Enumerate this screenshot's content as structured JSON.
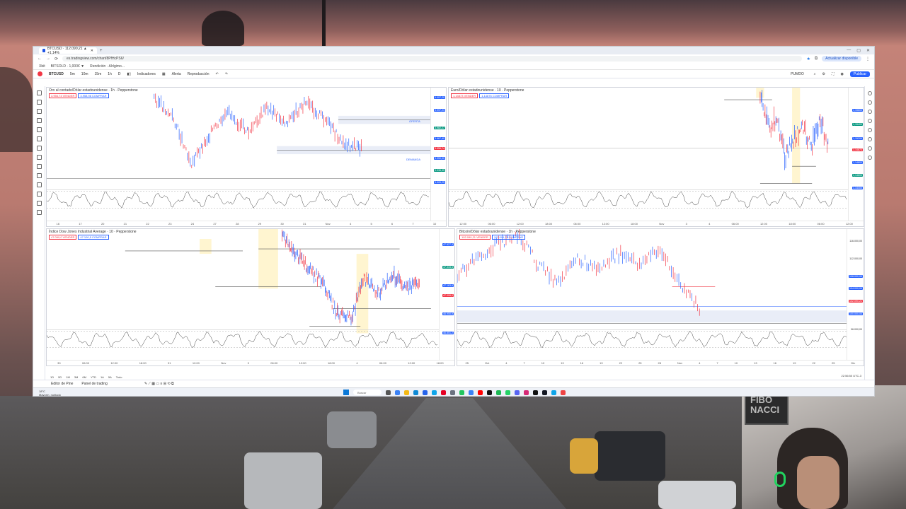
{
  "browser": {
    "tab_title": "BTCUSD · 112.090,21 ▲ +1,14%",
    "new_tab": "+",
    "url": "es.tradingview.com/chart/8PfHcPS6/",
    "account_button": "Actualizar disponible",
    "bookmarks": [
      "Xbit",
      "BITSOLD · 1,000€ ▼",
      "Rendición · Alrígimo..."
    ],
    "window_controls": [
      "—",
      "▢",
      "✕"
    ]
  },
  "toolbar": {
    "symbol": "BTCUSD",
    "intervals": [
      "5m",
      "10m",
      "15m",
      "1h",
      "D"
    ],
    "indicators_label": "Indicadores",
    "alert_label": "Alerta",
    "replay_label": "Reproducción",
    "layout_label": "PUMDO",
    "publish_label": "Publicar"
  },
  "panes": [
    {
      "title": "Oro al contado/Dólar estadounidense · 1h · Pepperstone",
      "sell": "3.956,74 VENDER",
      "buy": "3.958,98 COMPRAR",
      "zone_top": "OFERTA",
      "zone_bottom": "DEMANDA",
      "x_ticks": [
        "16",
        "17",
        "20",
        "21",
        "22",
        "23",
        "24",
        "27",
        "28",
        "29",
        "30",
        "31",
        "Nov",
        "4",
        "5",
        "6",
        "7",
        "10"
      ],
      "price_labels": [
        "4.007,20",
        "3.997,23",
        "3.982,27",
        "3.967,40",
        "3.956,74",
        "3.950,00",
        "3.936,35",
        "3.926,25"
      ]
    },
    {
      "title": "Euro/Dólar estadounidense · 10 · Pepperstone",
      "sell": "1,14873 VENDER",
      "buy": "1,14876 COMPRAR",
      "x_ticks": [
        "12:00",
        "06:00",
        "12:00",
        "18:00",
        "06:00",
        "12:00",
        "18:00",
        "Nov",
        "3",
        "4",
        "06:00",
        "12:00",
        "18:00",
        "06:00",
        "12:00"
      ],
      "price_labels": [
        "1,15600",
        "1,15400",
        "1,15200",
        "1,14873",
        "1,14800",
        "1,14600",
        "1,14400"
      ]
    },
    {
      "title": "Índice Dow Jones Industrial Average · 10 · Pepperstone",
      "sell": "47.099,0 VENDER",
      "buy": "47.100,5 COMPRAR",
      "x_ticks": [
        "30",
        "06:00",
        "12:00",
        "18:00",
        "31",
        "12:00",
        "Nov",
        "3",
        "06:00",
        "12:00",
        "18:00",
        "4",
        "06:00",
        "12:00",
        "18:00"
      ],
      "price_labels": [
        "47.527,3",
        "47.333,3",
        "47.163,6",
        "47.099,0",
        "46.950,9",
        "46.851,2"
      ]
    },
    {
      "title": "Bitcoin/Dólar estadounidense · 1h · Pepperstone",
      "sell": "102.090,21 VENDER",
      "buy": "102.094,11 COMPRAR",
      "x_ticks": [
        "25",
        "Oct",
        "4",
        "7",
        "10",
        "13",
        "16",
        "19",
        "22",
        "25",
        "28",
        "Nov",
        "4",
        "7",
        "10",
        "13",
        "16",
        "19",
        "22",
        "25",
        "Dic"
      ],
      "price_labels": [
        "116.000,00",
        "112.000,00",
        "108.000,00",
        "104.000,00",
        "102.090,21",
        "100.000,00",
        "96.000,00"
      ]
    }
  ],
  "range_buttons": [
    "1D",
    "5D",
    "1M",
    "3M",
    "6M",
    "YTD",
    "1A",
    "5A",
    "Todo"
  ],
  "timezone": "22:56:50 UTC-3",
  "bottom_tabs": [
    "Editor de Pine",
    "Panel de trading"
  ],
  "taskbar": {
    "weather_temp": "18°C",
    "weather_desc": "Mayorm. nublado",
    "search_placeholder": "Buscar"
  },
  "webcam_sign": "FIBO NACCI",
  "colors": {
    "up": "#2962ff",
    "down": "#f23645",
    "zone": "#fff3c4",
    "oscillator": "#444444"
  }
}
